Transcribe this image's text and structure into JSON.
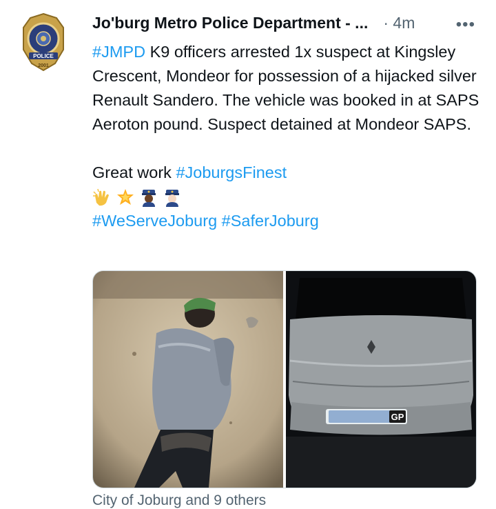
{
  "account": {
    "name": "Jo'burg Metro Police Department - ...",
    "time": "· 4m",
    "badge_text": "POLICE",
    "badge_year": "2001",
    "badge_ring": "JOHANNESBURG METROPOLITAN"
  },
  "tweet": {
    "hashtag1": "#JMPD",
    "text1": " K9 officers arrested 1x suspect at Kingsley Crescent, Mondeor for possession of a hijacked silver Renault Sandero. The vehicle was booked in at SAPS Aeroton pound. Suspect detained at Mondeor SAPS.",
    "text2": "Great work ",
    "hashtag2": "#JoburgsFinest",
    "hashtag3": "#WeServeJoburg",
    "hashtag4": "#SaferJoburg",
    "emojis": [
      "clapping-hands",
      "glowing-star",
      "police-officer-dark",
      "police-officer-light"
    ]
  },
  "media": {
    "plate_text": "GP",
    "colors": {
      "wall": "#c9b9a0",
      "hoodie": "#8d96a3",
      "cap": "#4f8a4a",
      "car": "#9ba0a3"
    }
  },
  "footer": {
    "likes_text": "City of Joburg and 9 others"
  },
  "colors": {
    "link": "#1d9bf0",
    "muted": "#536471",
    "text": "#0f1419"
  }
}
